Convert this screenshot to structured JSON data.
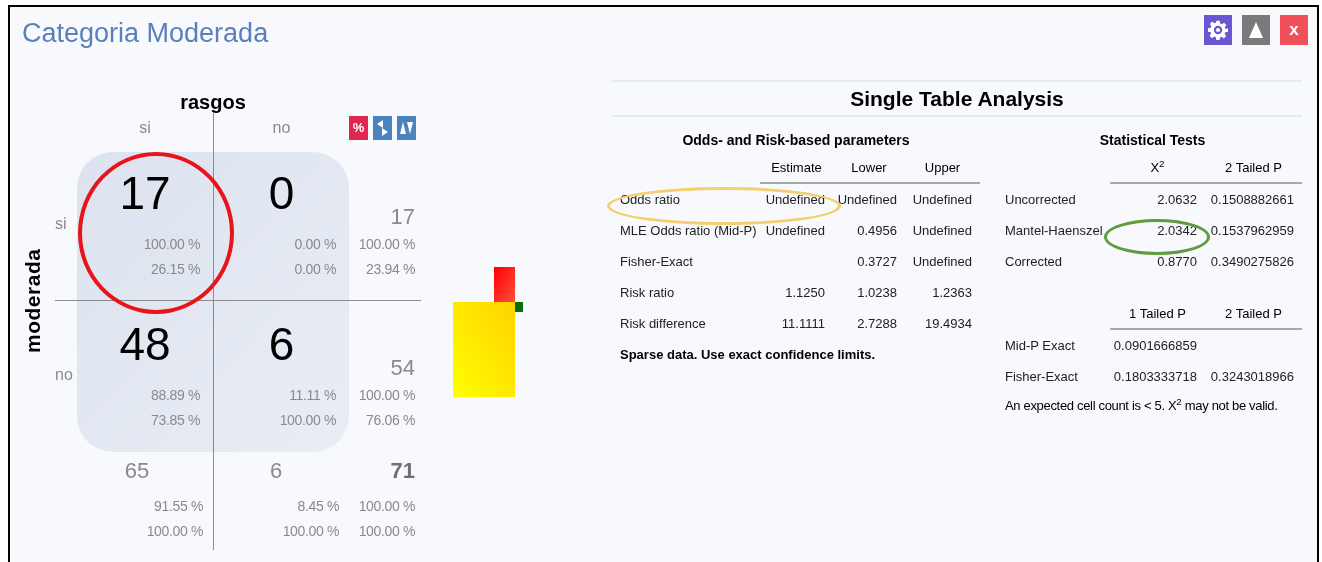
{
  "window": {
    "title": "Categoria Moderada"
  },
  "window_buttons": [
    {
      "kind": "settings"
    },
    {
      "kind": "collapse"
    },
    {
      "kind": "close",
      "label": "x"
    }
  ],
  "crosstab": {
    "row_variable": "moderada",
    "column_variable": "rasgos",
    "column_labels": [
      "si",
      "no"
    ],
    "toggles": [
      {
        "kind": "percent",
        "label": "%"
      },
      {
        "kind": "swap"
      },
      {
        "kind": "sort"
      }
    ],
    "rows": [
      {
        "label": "si",
        "cells": [
          {
            "count": "17",
            "row_pct": "100.00 %",
            "col_pct": "26.15 %"
          },
          {
            "count": "0",
            "row_pct": "0.00 %",
            "col_pct": "0.00 %"
          }
        ],
        "total": {
          "count": "17",
          "row_pct": "100.00 %",
          "col_pct": "23.94 %"
        }
      },
      {
        "label": "no",
        "cells": [
          {
            "count": "48",
            "row_pct": "88.89 %",
            "col_pct": "73.85 %"
          },
          {
            "count": "6",
            "row_pct": "11.11 %",
            "col_pct": "100.00 %"
          }
        ],
        "total": {
          "count": "54",
          "row_pct": "100.00 %",
          "col_pct": "76.06 %"
        }
      }
    ],
    "totals": [
      {
        "count": "65",
        "row_pct": "91.55 %",
        "col_pct": "100.00 %"
      },
      {
        "count": "6",
        "row_pct": "8.45 %",
        "col_pct": "100.00 %"
      }
    ],
    "grand_total": {
      "count": "71",
      "row_pct": "100.00 %",
      "col_pct": "100.00 %"
    }
  },
  "analysis": {
    "title": "Single Table Analysis",
    "parameters": {
      "heading": "Odds- and Risk-based parameters",
      "columns": [
        "Estimate",
        "Lower",
        "Upper"
      ],
      "rows": [
        {
          "label": "Odds ratio",
          "estimate": "Undefined",
          "lower": "Undefined",
          "upper": "Undefined"
        },
        {
          "label": "MLE Odds ratio (Mid-P)",
          "estimate": "Undefined",
          "lower": "0.4956",
          "upper": "Undefined"
        },
        {
          "label": "Fisher-Exact",
          "lower": "0.3727",
          "upper": "Undefined"
        },
        {
          "label": "Risk ratio",
          "estimate": "1.1250",
          "lower": "1.0238",
          "upper": "1.2363"
        },
        {
          "label": "Risk difference",
          "estimate": "11.1111",
          "lower": "2.7288",
          "upper": "19.4934"
        }
      ],
      "note": "Sparse data. Use exact confidence limits."
    },
    "tests": {
      "heading": "Statistical Tests",
      "sections": [
        {
          "columns": [
            "X$^{2}$",
            "2 Tailed P"
          ],
          "rows": [
            {
              "label": "Uncorrected",
              "chi_square": "2.0632",
              "two_tailed_p": "0.1508882661"
            },
            {
              "label": "Mantel-Haenszel",
              "chi_square": "2.0342",
              "two_tailed_p": "0.1537962959"
            },
            {
              "label": "Corrected",
              "chi_square": "0.8770",
              "two_tailed_p": "0.3490275826"
            }
          ]
        },
        {
          "columns": [
            "1 Tailed P",
            "2 Tailed P"
          ],
          "rows": [
            {
              "label": "Mid-P Exact",
              "one_tailed_p": "0.0901666859"
            },
            {
              "label": "Fisher-Exact",
              "one_tailed_p": "0.1803333718",
              "two_tailed_p": "0.3243018966"
            }
          ]
        }
      ],
      "note": "An expected cell count is < 5. X$^{2}$ may not be valid."
    }
  },
  "annotations": [
    {
      "kind": "circle",
      "color": "#e8131b"
    },
    {
      "kind": "ellipse",
      "color": "#f5cf6e"
    },
    {
      "kind": "ellipse",
      "color": "#5e9c3e"
    }
  ]
}
